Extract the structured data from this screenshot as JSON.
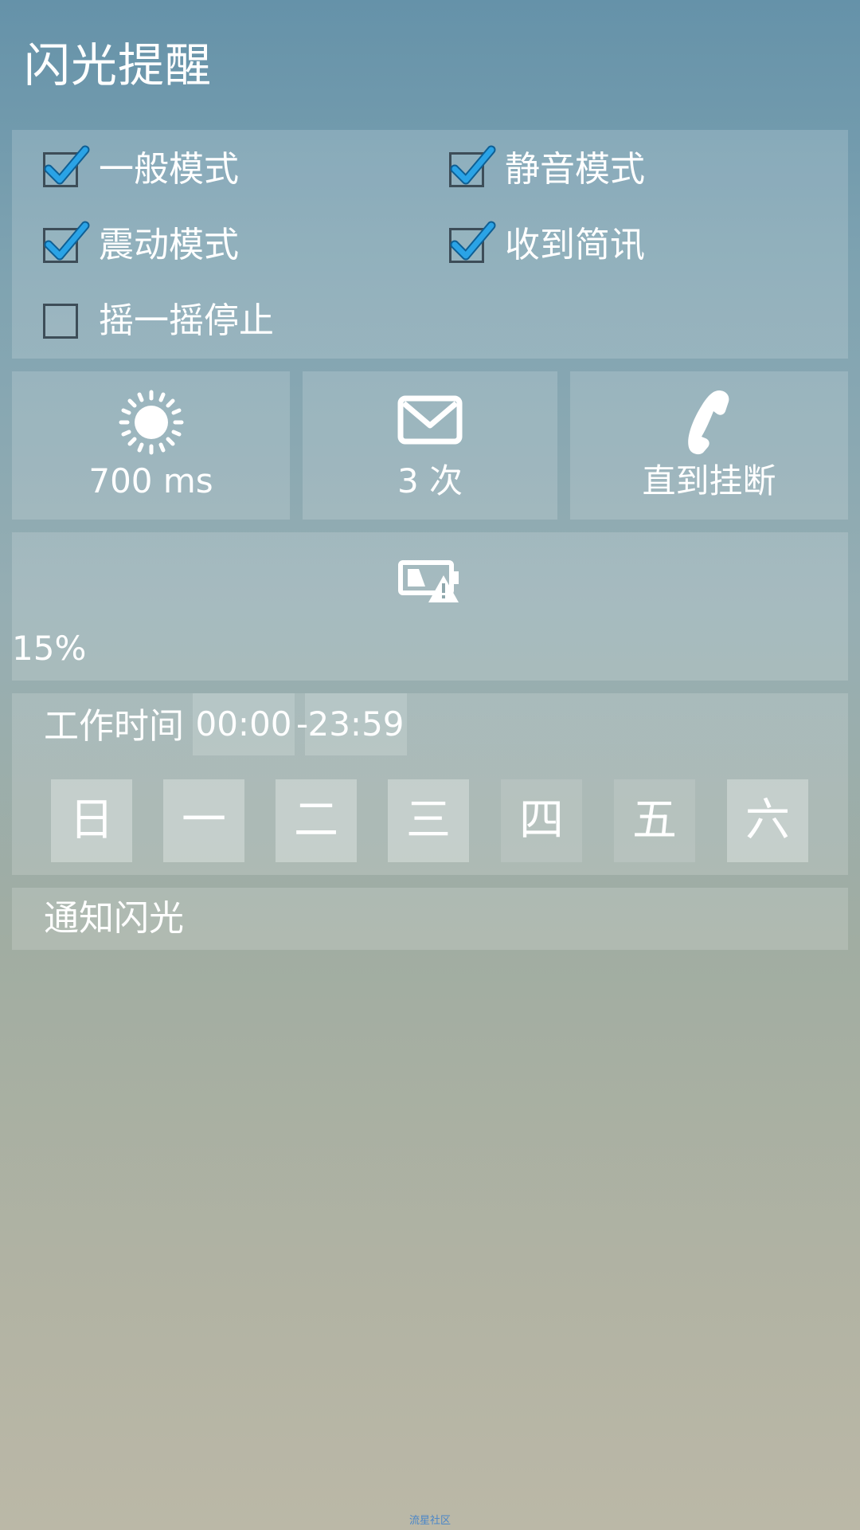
{
  "header": {
    "title": "闪光提醒"
  },
  "modes": {
    "normal": {
      "label": "一般模式",
      "checked": true
    },
    "silent": {
      "label": "静音模式",
      "checked": true
    },
    "vibrate": {
      "label": "震动模式",
      "checked": true
    },
    "sms": {
      "label": "收到简讯",
      "checked": true
    },
    "shake_stop": {
      "label": "摇一摇停止",
      "checked": false
    }
  },
  "settings": {
    "flash_duration": {
      "icon": "sun-icon",
      "value": "700 ms"
    },
    "flash_count": {
      "icon": "envelope-icon",
      "value": "3 次"
    },
    "call_mode": {
      "icon": "phone-icon",
      "value": "直到挂断"
    },
    "low_battery": {
      "icon": "battery-warning-icon",
      "value": "15%"
    }
  },
  "work_time": {
    "label": "工作时间",
    "start": "00:00",
    "separator": "-",
    "end": "23:59",
    "days": [
      {
        "label": "日",
        "active": true
      },
      {
        "label": "一",
        "active": true
      },
      {
        "label": "二",
        "active": true
      },
      {
        "label": "三",
        "active": true
      },
      {
        "label": "四",
        "active": false
      },
      {
        "label": "五",
        "active": false
      },
      {
        "label": "六",
        "active": true
      }
    ]
  },
  "notification_flash": {
    "label": "通知闪光"
  },
  "footer": {
    "watermark": "流星社区"
  },
  "colors": {
    "checkbox_border": "#3d4d58",
    "checkmark": "#1f8fd6",
    "watermark": "#4a86c8"
  }
}
